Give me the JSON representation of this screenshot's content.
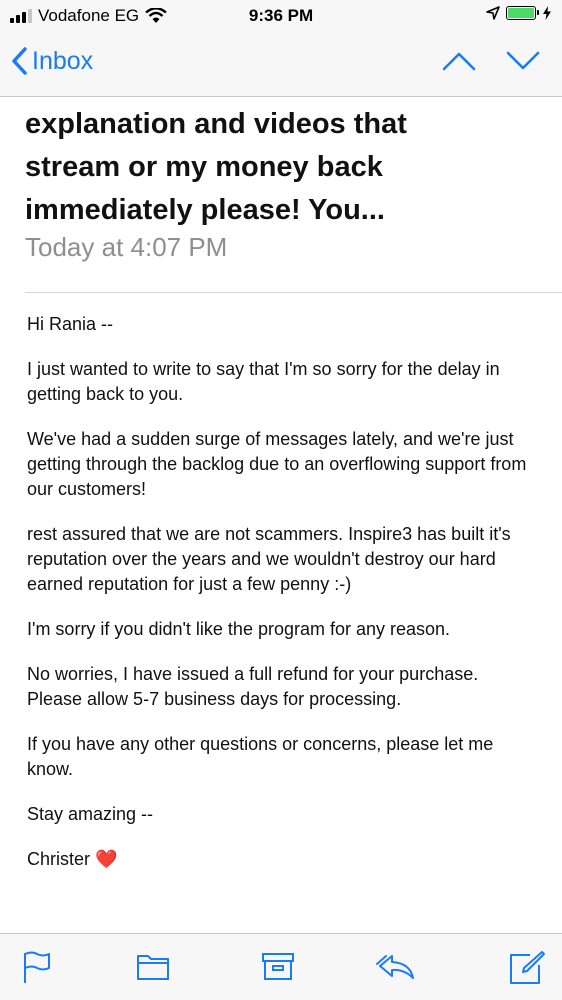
{
  "status_bar": {
    "carrier": "Vodafone EG",
    "time": "9:36 PM",
    "battery_level": 1.0,
    "icons": [
      "signal-icon",
      "wifi-icon",
      "location-arrow-icon",
      "battery-icon",
      "charging-bolt-icon"
    ]
  },
  "nav": {
    "back_label": "Inbox",
    "icons": [
      "chevron-left-icon",
      "chevron-up-icon",
      "chevron-down-icon"
    ],
    "accent_color": "#1a7cf5"
  },
  "email": {
    "subject_lines": [
      "explanation and videos that",
      "stream or my money back",
      "immediately please! You..."
    ],
    "date": "Today at 4:07 PM",
    "body": {
      "greeting": "Hi Rania --",
      "p1": "I just wanted to write to say that I'm so sorry for the delay in getting back to you.",
      "p2": "We've had a sudden surge of messages lately, and we're just getting through the backlog due to an overflowing support from our customers!",
      "p3": "rest assured that we are not scammers. Inspire3 has built it's reputation over the years and we wouldn't destroy our hard earned reputation for just a few penny :-)",
      "p4": "I'm sorry if you didn't like the program for any reason.",
      "p5": "No worries, I have issued a full refund for your purchase. Please allow 5-7 business days for processing.",
      "p6": "If you have any other questions or concerns, please let me know.",
      "closing": "Stay amazing --",
      "signature": "Christer",
      "signature_emoji": "❤️"
    }
  },
  "toolbar": {
    "icons": [
      "flag-icon",
      "folder-icon",
      "archive-icon",
      "reply-icon",
      "compose-icon"
    ]
  }
}
